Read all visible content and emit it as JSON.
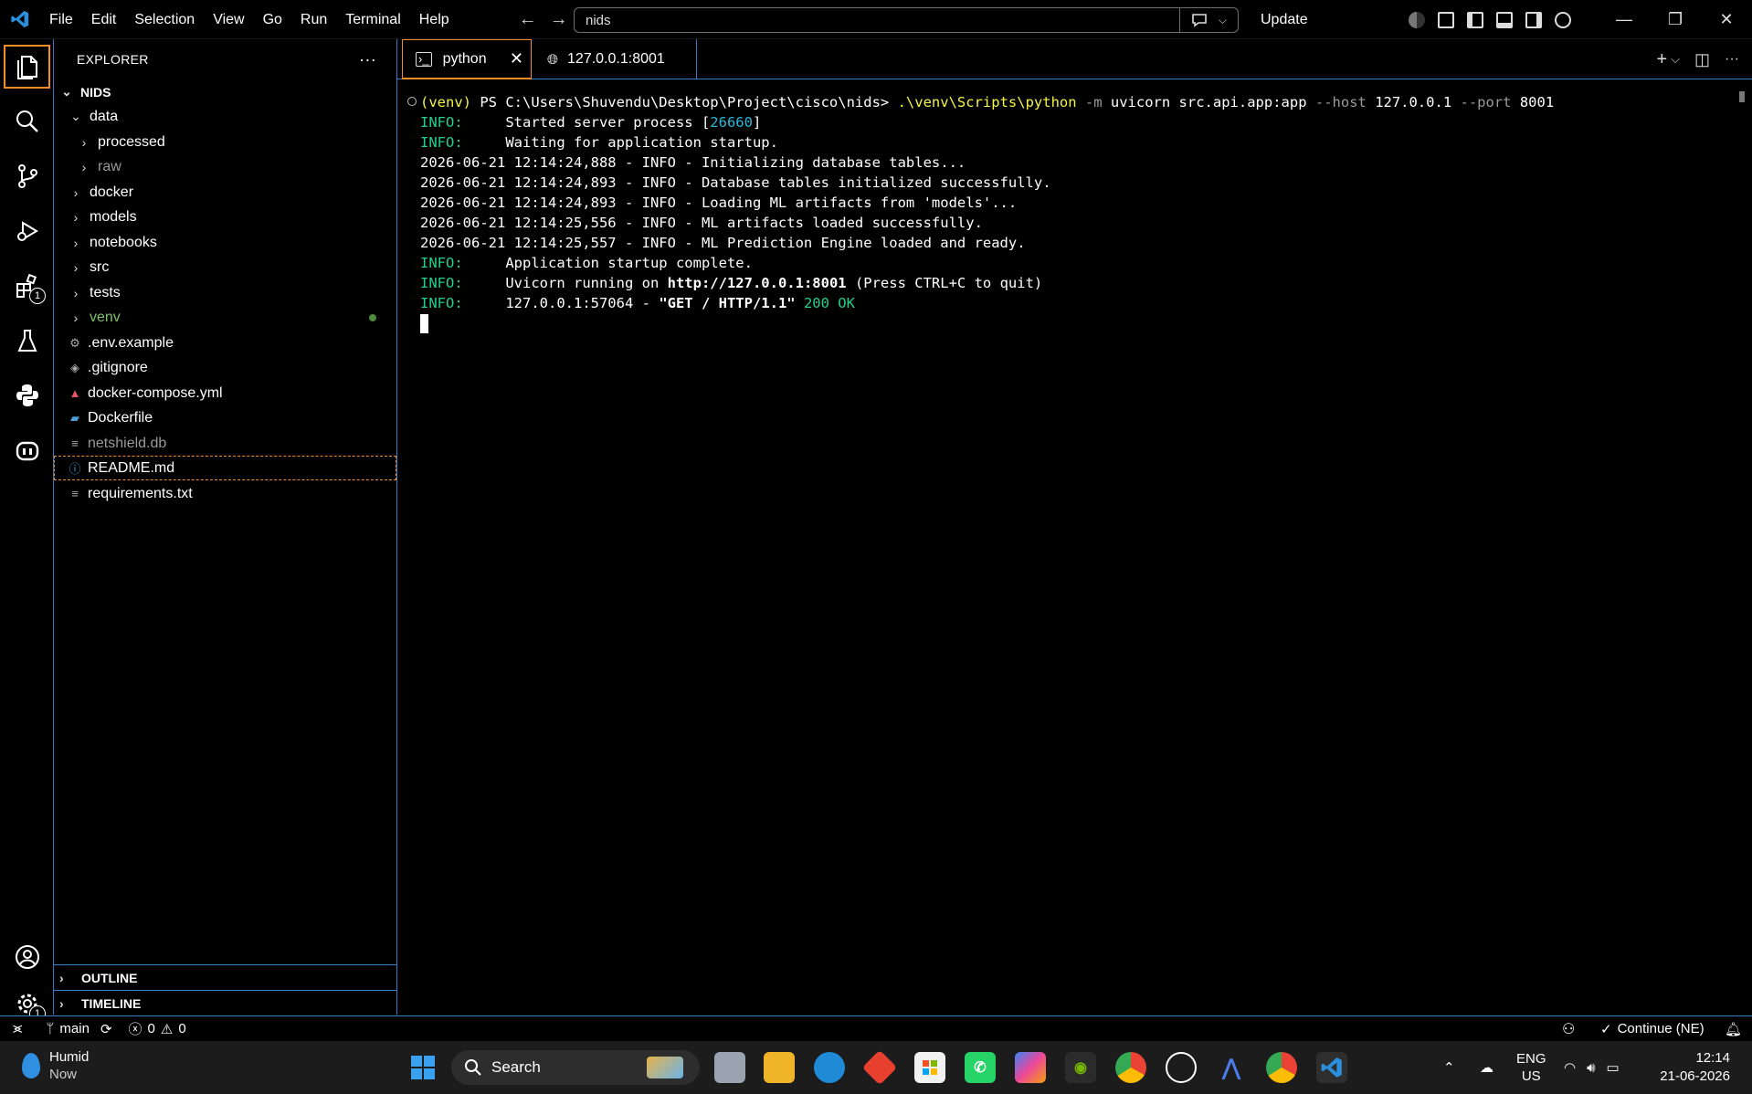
{
  "titlebar": {
    "menu": [
      "File",
      "Edit",
      "Selection",
      "View",
      "Go",
      "Run",
      "Terminal",
      "Help"
    ],
    "search_text": "nids",
    "update_label": "Update"
  },
  "activity": {
    "extensions_badge": "1",
    "settings_badge": "1"
  },
  "explorer": {
    "title": "EXPLORER",
    "more": "···",
    "root": "NIDS",
    "items": [
      {
        "label": "data"
      },
      {
        "label": "processed"
      },
      {
        "label": "raw"
      },
      {
        "label": "docker"
      },
      {
        "label": "models"
      },
      {
        "label": "notebooks"
      },
      {
        "label": "src"
      },
      {
        "label": "tests"
      },
      {
        "label": "venv"
      },
      {
        "label": ".env.example"
      },
      {
        "label": ".gitignore"
      },
      {
        "label": "docker-compose.yml"
      },
      {
        "label": "Dockerfile"
      },
      {
        "label": "netshield.db"
      },
      {
        "label": "README.md"
      },
      {
        "label": "requirements.txt"
      }
    ],
    "outline": "OUTLINE",
    "timeline": "TIMELINE"
  },
  "tabs": [
    {
      "label": "python"
    },
    {
      "label": "127.0.0.1:8001"
    }
  ],
  "terminal": {
    "prompt": {
      "venv": "(venv)",
      "ps": " PS C:\\Users\\Shuvendu\\Desktop\\Project\\cisco\\nids> ",
      "exe": ".\\venv\\Scripts\\python",
      "flag_m": " -m",
      "module": " uvicorn src.api.app:app",
      "flag_host": " --host",
      "host": " 127.0.0.1",
      "flag_port": " --port",
      "port": " 8001"
    },
    "lines": [
      {
        "prefix": "INFO:",
        "text": "     Started server process [",
        "pid": "26660",
        "suffix": "]"
      },
      {
        "prefix": "INFO:",
        "text": "     Waiting for application startup."
      },
      {
        "text": "2026-06-21 12:14:24,888 - INFO - Initializing database tables..."
      },
      {
        "text": "2026-06-21 12:14:24,893 - INFO - Database tables initialized successfully."
      },
      {
        "text": "2026-06-21 12:14:24,893 - INFO - Loading ML artifacts from 'models'..."
      },
      {
        "text": "2026-06-21 12:14:25,556 - INFO - ML artifacts loaded successfully."
      },
      {
        "text": "2026-06-21 12:14:25,557 - INFO - ML Prediction Engine loaded and ready."
      },
      {
        "prefix": "INFO:",
        "text": "     Application startup complete."
      },
      {
        "prefix": "INFO:",
        "text": "     Uvicorn running on ",
        "bold": "http://127.0.0.1:8001",
        "suffix": " (Press CTRL+C to quit)"
      },
      {
        "prefix": "INFO:",
        "text": "     127.0.0.1:57064 - ",
        "bold": "\"GET / HTTP/1.1\"",
        "status": " 200 OK"
      }
    ]
  },
  "statusbar": {
    "branch": "main",
    "errors": "0",
    "warnings": "0",
    "continue": "Continue (NE)"
  },
  "taskbar": {
    "weather_title": "Humid",
    "weather_sub": "Now",
    "search": "Search",
    "lang1": "ENG",
    "lang2": "US",
    "time": "12:14",
    "date": "21-06-2026"
  },
  "colors": {
    "accent_orange": "#f28c28",
    "border_blue": "#3a7cc4",
    "terminal_green": "#23d18b",
    "terminal_yellow": "#f5f543"
  }
}
